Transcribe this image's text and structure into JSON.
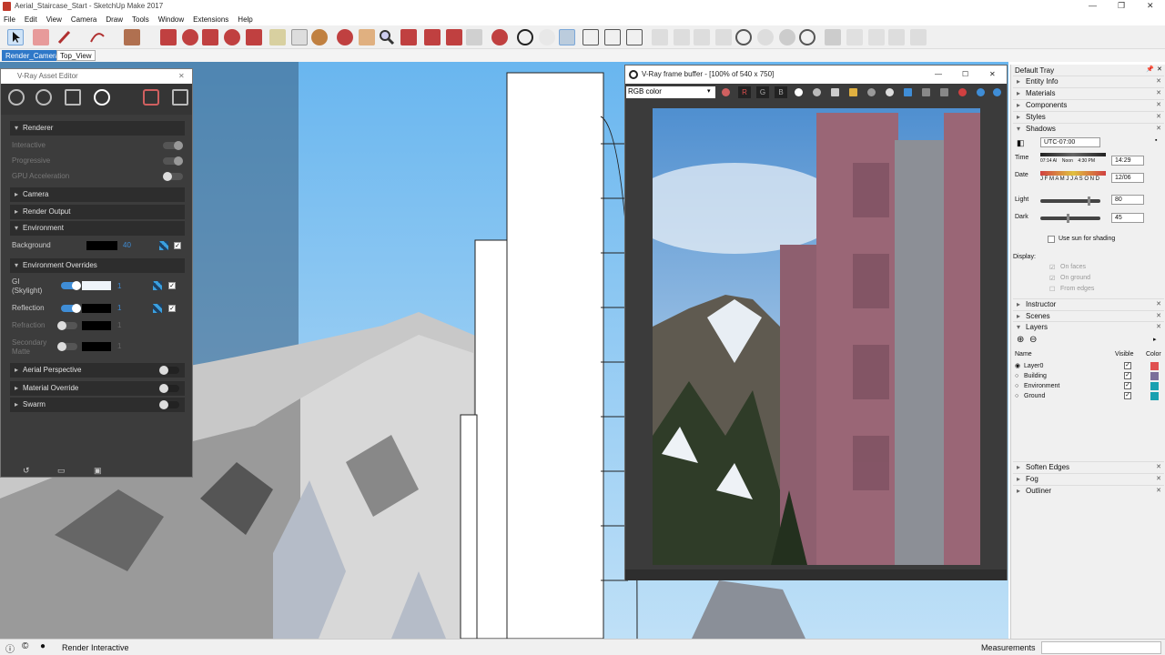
{
  "window": {
    "title": "Aerial_Staircase_Start - SketchUp Make 2017"
  },
  "menu": [
    "File",
    "Edit",
    "View",
    "Camera",
    "Draw",
    "Tools",
    "Window",
    "Extensions",
    "Help"
  ],
  "scene_tabs": [
    "Render_Camera",
    "Top_View"
  ],
  "asset_editor": {
    "title": "V-Ray Asset Editor",
    "sections": {
      "renderer": "Renderer",
      "interactive": "Interactive",
      "progressive": "Progressive",
      "gpu": "GPU Acceleration",
      "camera": "Camera",
      "render_output": "Render Output",
      "environment": "Environment",
      "background": "Background",
      "background_value": "40",
      "env_overrides": "Environment Overrides",
      "gi": "GI\n(Skylight)",
      "gi_value": "1",
      "reflection": "Reflection",
      "reflection_value": "1",
      "refraction": "Refraction",
      "refraction_value": "1",
      "secondary": "Secondary\nMatte",
      "secondary_value": "1",
      "aerial": "Aerial Perspective",
      "material_override": "Material Override",
      "swarm": "Swarm"
    }
  },
  "frame_buffer": {
    "title": "V-Ray frame buffer - [100% of 540 x 750]",
    "channel": "RGB color",
    "r": "R",
    "g": "G",
    "b": "B"
  },
  "tray": {
    "title": "Default Tray",
    "entity_info": "Entity Info",
    "materials": "Materials",
    "components": "Components",
    "styles": "Styles",
    "shadows": "Shadows",
    "timezone": "UTC-07:00",
    "time_label": "Time",
    "time_ticks": "07:14 AI    Noon    4:30 PM",
    "time_value": "14:29",
    "date_label": "Date",
    "date_ticks": "J F M A M J J A S O N D",
    "date_value": "12/06",
    "light_label": "Light",
    "light_value": "80",
    "light_level": 0.8,
    "dark_label": "Dark",
    "dark_value": "45",
    "dark_level": 0.45,
    "use_sun": "Use sun for shading",
    "display": "Display:",
    "on_faces": "On faces",
    "on_ground": "On ground",
    "from_edges": "From edges",
    "instructor": "Instructor",
    "scenes": "Scenes",
    "layers": "Layers",
    "col_name": "Name",
    "col_visible": "Visible",
    "col_color": "Color",
    "layer_rows": [
      {
        "name": "Layer0",
        "color": "#e05050"
      },
      {
        "name": "Building",
        "color": "#7a6f9a"
      },
      {
        "name": "Environment",
        "color": "#1aa0b0"
      },
      {
        "name": "Ground",
        "color": "#1aa0b0"
      }
    ],
    "soften_edges": "Soften Edges",
    "fog": "Fog",
    "outliner": "Outliner"
  },
  "status": {
    "text": "Render Interactive",
    "measurements": "Measurements"
  }
}
